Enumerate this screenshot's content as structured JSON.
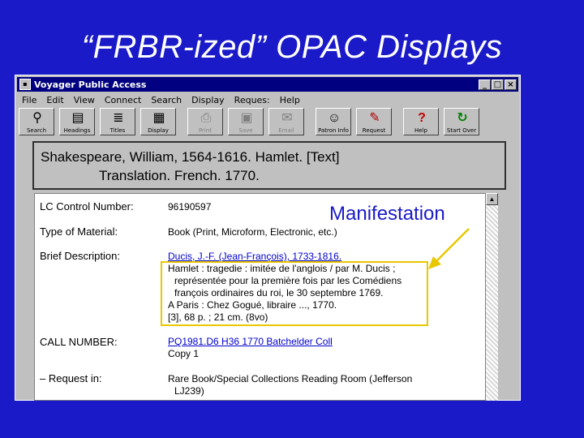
{
  "slide": {
    "title": "“FRBR-ized” OPAC Displays"
  },
  "window": {
    "title": "Voyager Public Access",
    "controls": [
      "_",
      "□",
      "×"
    ]
  },
  "menu": [
    "File",
    "Edit",
    "View",
    "Connect",
    "Search",
    "Display",
    "Reques:",
    "Help"
  ],
  "toolbar": [
    {
      "label": "Search",
      "icon": "binoculars-icon",
      "glyph": "⚲"
    },
    {
      "label": "Headings",
      "icon": "headings-icon",
      "glyph": "▤"
    },
    {
      "label": "Titles",
      "icon": "titles-icon",
      "glyph": "≣"
    },
    {
      "label": "Display",
      "icon": "display-icon",
      "glyph": "▦"
    },
    {
      "label": "Print",
      "icon": "printer-icon",
      "glyph": "⎙"
    },
    {
      "label": "Save",
      "icon": "floppy-icon",
      "glyph": "▣"
    },
    {
      "label": "Email",
      "icon": "email-icon",
      "glyph": "✉"
    },
    {
      "label": "Patron Info",
      "icon": "patron-icon",
      "glyph": "☺"
    },
    {
      "label": "Request",
      "icon": "request-icon",
      "glyph": "✎"
    },
    {
      "label": "Help",
      "icon": "help-icon",
      "glyph": "?"
    },
    {
      "label": "Start Over",
      "icon": "start-over-icon",
      "glyph": "↻"
    }
  ],
  "record_heading": {
    "line1": "Shakespeare, William, 1564-1616.  Hamlet. [Text]",
    "line2": "Translation.  French.  1770."
  },
  "annotation": {
    "label": "Manifestation"
  },
  "record": {
    "lc_label": "LC Control Number:",
    "lc_value": "96190597",
    "type_label": "Type of Material:",
    "type_value": "Book (Print, Microform, Electronic, etc.)",
    "brief_label": "Brief Description:",
    "brief_author": "Ducis, J.-F. (Jean-François), 1733-1816.",
    "brief_lines": [
      "Hamlet : tragedie : imitée de l'anglois / par M. Ducis ;",
      "représentée pour la première fois par les Comédiens",
      "françois ordinaires du roi, le 30 septembre 1769.",
      "A Paris : Chez Gogué, libraire ..., 1770.",
      "[3], 68 p. ; 21 cm. (8vo)"
    ],
    "call_label": "CALL NUMBER:",
    "call_value": "PQ1981.D6 H36 1770 Batchelder Coll",
    "copy_value": "Copy 1",
    "request_label": "– Request in:",
    "request_value": "Rare Book/Special Collections Reading Room (Jefferson",
    "request_value2": "LJ239)"
  }
}
